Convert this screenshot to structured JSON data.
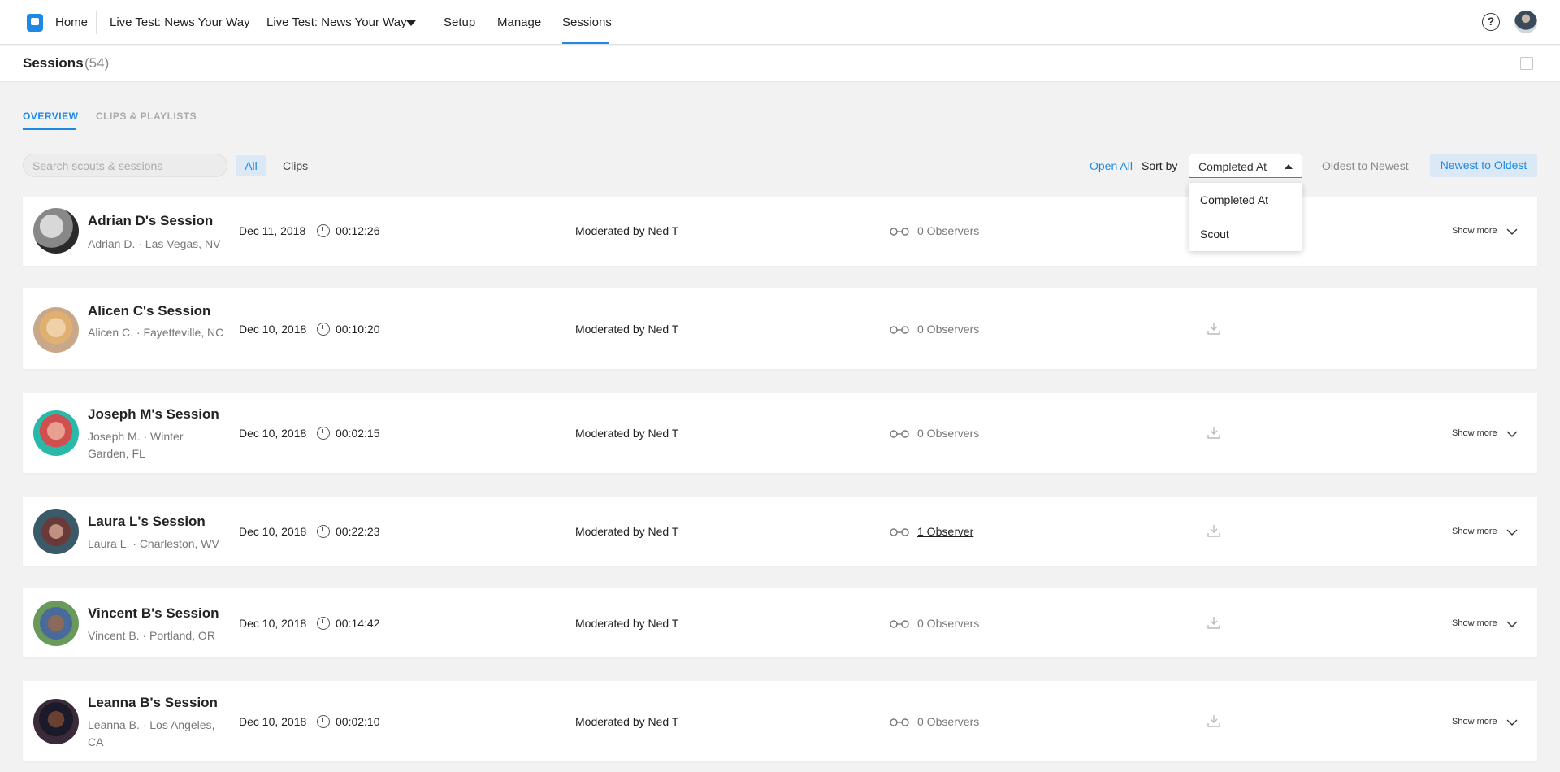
{
  "nav": {
    "home": "Home",
    "project": "Live Test: News Your Way",
    "project_dropdown": "Live Test: News Your Way",
    "setup": "Setup",
    "manage": "Manage",
    "sessions": "Sessions",
    "help": "?"
  },
  "header": {
    "title": "Sessions",
    "count": "(54)"
  },
  "tabs": {
    "overview": "OVERVIEW",
    "clips": "CLIPS & PLAYLISTS"
  },
  "filters": {
    "search_placeholder": "Search scouts & sessions",
    "all": "All",
    "clips": "Clips",
    "open_all": "Open All",
    "sort_by": "Sort by",
    "sort_selected": "Completed At",
    "sort_options": [
      "Completed At",
      "Scout"
    ],
    "oldest": "Oldest to Newest",
    "newest": "Newest to Oldest"
  },
  "colors": {
    "accent": "#1e88e5",
    "active_pill": "#dbe9f7",
    "background": "#f2f2f2"
  },
  "sessions": [
    {
      "name": "Adrian D's Session",
      "location": "Adrian D. · Las Vegas, NV",
      "date": "Dec 11, 2018",
      "duration": "00:12:26",
      "moderator": "Moderated by Ned T",
      "observers": "0 Observers",
      "show_more": "Show more"
    },
    {
      "name": "Alicen C's Session",
      "location": "Alicen C. · Fayetteville, NC",
      "date": "Dec 10, 2018",
      "duration": "00:10:20",
      "moderator": "Moderated by Ned T",
      "observers": "0 Observers"
    },
    {
      "name": "Joseph M's Session",
      "location": "Joseph M. · Winter Garden, FL",
      "date": "Dec 10, 2018",
      "duration": "00:02:15",
      "moderator": "Moderated by Ned T",
      "observers": "0 Observers",
      "show_more": "Show more"
    },
    {
      "name": "Laura L's Session",
      "location": "Laura L. · Charleston, WV",
      "date": "Dec 10, 2018",
      "duration": "00:22:23",
      "moderator": "Moderated by Ned T",
      "observers": "1 Observer",
      "show_more": "Show more"
    },
    {
      "name": "Vincent B's Session",
      "location": "Vincent B. · Portland, OR",
      "date": "Dec 10, 2018",
      "duration": "00:14:42",
      "moderator": "Moderated by Ned T",
      "observers": "0 Observers",
      "show_more": "Show more"
    },
    {
      "name": "Leanna B's Session",
      "location": "Leanna B. · Los Angeles, CA",
      "date": "Dec 10, 2018",
      "duration": "00:02:10",
      "moderator": "Moderated by Ned T",
      "observers": "0 Observers",
      "show_more": "Show more"
    }
  ]
}
